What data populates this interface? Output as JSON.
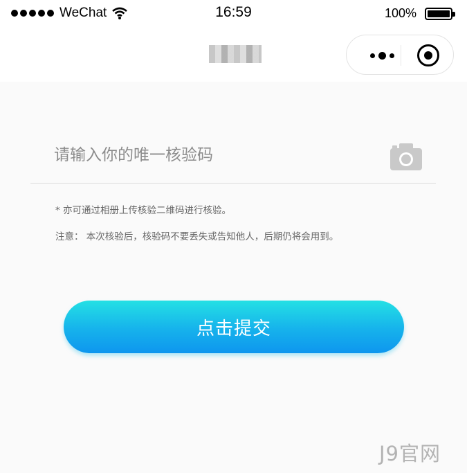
{
  "status_bar": {
    "carrier": "WeChat",
    "time": "16:59",
    "battery": "100%",
    "battery_level": 1.0,
    "signal_bars": 5
  },
  "nav": {
    "menu_icon": "more-dots-icon",
    "close_icon": "target-icon"
  },
  "form": {
    "code_placeholder": "请输入你的唯一核验码",
    "code_value": "",
    "scan_icon": "camera-icon",
    "hint_upload": "* 亦可通过相册上传核验二维码进行核验。",
    "hint_note": "注意： 本次核验后，核验码不要丢失或告知他人，后期仍将会用到。",
    "submit_label": "点击提交"
  },
  "watermark": "J9官网",
  "colors": {
    "button_top": "#24e0e4",
    "button_bottom": "#0e96ee",
    "placeholder": "#8c8c8c",
    "hint_text": "#666666",
    "divider": "#dcdcdc"
  }
}
